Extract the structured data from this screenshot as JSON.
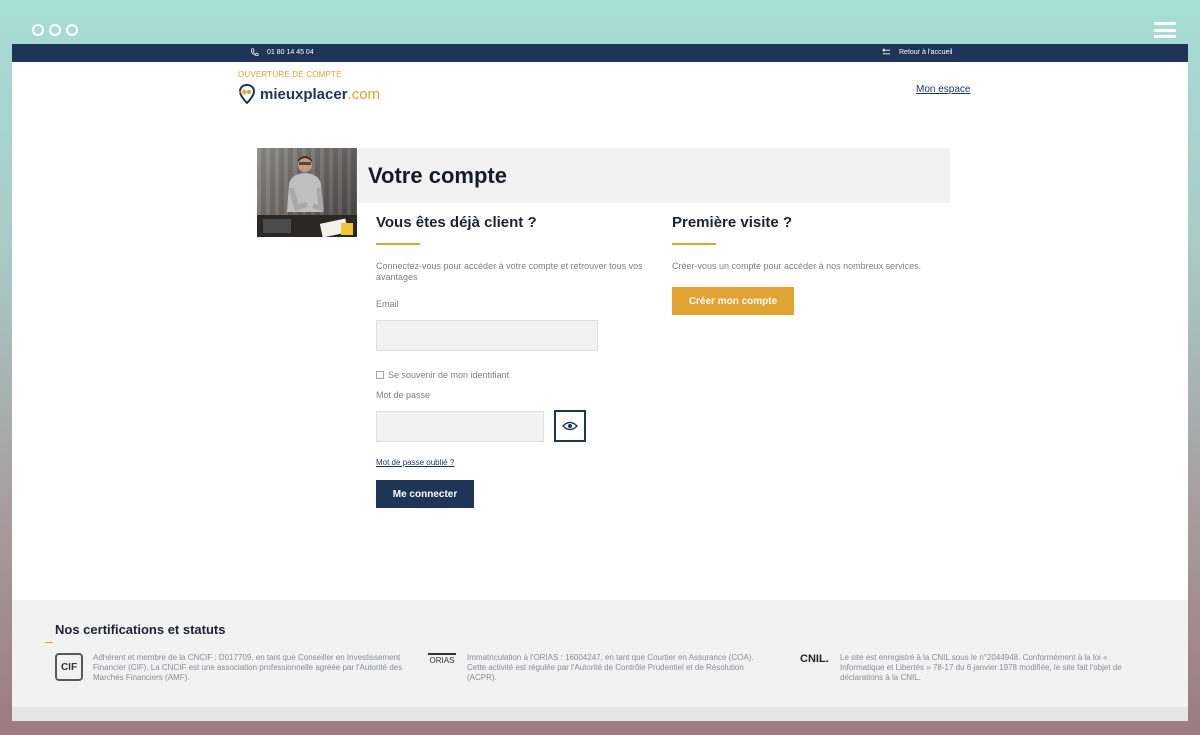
{
  "topbar": {
    "phone": "01 80 14 45 04",
    "back_link": "Retour à l'accueil"
  },
  "header": {
    "eyebrow": "OUVERTURE DE COMPTE",
    "logo_main": "mieuxplacer",
    "logo_tld": ".com",
    "account_link": "Mon espace"
  },
  "hero": {
    "title": "Votre compte"
  },
  "login": {
    "heading": "Vous êtes déjà client ?",
    "description": "Connectez-vous pour accéder à votre compte et retrouver tous vos avantages",
    "email_label": "Email",
    "email_value": "",
    "remember_label": "Se souvenir de mon identifiant",
    "password_label": "Mot de passe",
    "password_value": "",
    "forgot_link": "Mot de passe oublié ?",
    "submit_label": "Me connecter"
  },
  "signup": {
    "heading": "Première visite ?",
    "description": "Créer-vous un compte pour accéder à nos nombreux services.",
    "button_label": "Créer mon compte"
  },
  "footer": {
    "heading": "Nos certifications et statuts",
    "certs": [
      {
        "logo": "CIF",
        "text": "Adhérent et membre de la CNCIF : D017709, en tant que Conseiller en Investissement Financier (CIF). La CNCIF est une association professionnelle agréée par l'Autorité des Marchés Financiers (AMF)."
      },
      {
        "logo": "ORIAS",
        "text": "Immatriculation à l'ORIAS : 16004247, en tant que Courtier en Assurance (COA). Cette activité est régulée par l'Autorité de Contrôle Prudentiel et de Résolution (ACPR)."
      },
      {
        "logo": "CNIL.",
        "text": "Le site est enregistré à la CNIL sous le n°2044948. Conformément à la loi « Informatique et Libertés » 78-17 du 6 janvier 1978 modifiée, le site fait l'objet de déclarations à la CNIL."
      }
    ]
  },
  "colors": {
    "navy": "#1e3558",
    "accent": "#e3a332",
    "panel": "#f2f2f2"
  },
  "icons": [
    "phone-icon",
    "back-arrow-icon",
    "logo-pin-icon",
    "eye-icon",
    "menu-icon"
  ]
}
